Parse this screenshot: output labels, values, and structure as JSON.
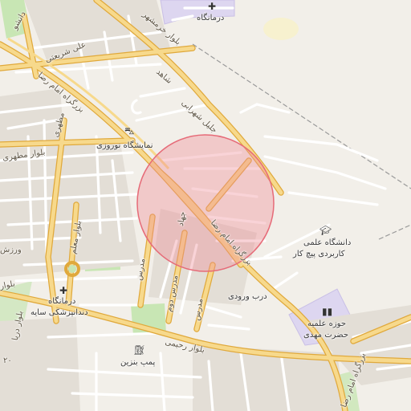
{
  "labels": {
    "clinic_top": "درمانگاه",
    "sh_danesh": "دانشو",
    "sh_sharifi": "علی شریعتی",
    "sh_kharmshahr": "بلوار خرمشهر",
    "sh_shahed": "شاهد",
    "sh_emam_reza_left": "بزرگراه امام رضا",
    "sh_motahari": "مطهری",
    "sh_jalil": "جلیل شهرابی",
    "nowruzi": "نمایشگاه نوروزی",
    "sh_blvd_mot": "بلوار مطهری",
    "sh_jahad": "جهاد",
    "sh_emam_reza_mid": "بزرگراه امام رضا",
    "sh_moallem": "بلوار معلم",
    "sh_varzesh": "ورزش",
    "sh_madras1": "مدرس",
    "sh_madras2": "مدرس دوم",
    "sh_madras3": "مدرس",
    "sh_blvd_l": "بلوار",
    "clinic_left_1": "درمانگاه",
    "clinic_left_2": "دندانپزشکی سایه",
    "darb": "درب ورودی",
    "uni_1": "دانشگاه علمی",
    "uni_2": "کاربردی پیچ کار",
    "hawza_1": "حوزه علمیه",
    "hawza_2": "حضرت مهدی",
    "sh_rahimi": "بلوار رحیمی",
    "gas": "پمپ بنزین",
    "sh_emam_reza_bot": "بزرگراه امام رضا",
    "sh_bottom_left": "۲۰",
    "sh_left_vert": "بلوار دریا"
  },
  "icons": {
    "clinic": "cross-icon",
    "car": "car-icon",
    "university": "graduation-cap-icon",
    "hawza": "building-icon",
    "fuel": "fuel-pump-icon"
  },
  "colors": {
    "background": "#f2efe9",
    "major_road": "#f4c96a",
    "major_road_casing": "#e0a93c",
    "minor_road": "#ffffff",
    "park": "#c8e6b4",
    "highlight_circle": "#f08c96",
    "purple_area": "#ddd6f0"
  }
}
